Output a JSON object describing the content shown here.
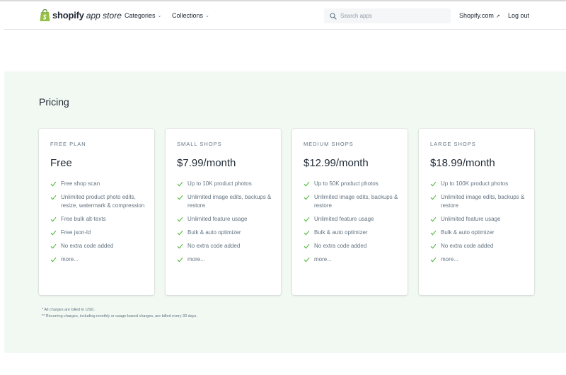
{
  "header": {
    "brand_bold": "shopify",
    "brand_sub": "app store",
    "nav": [
      {
        "label": "Categories"
      },
      {
        "label": "Collections"
      }
    ],
    "search_placeholder": "Search apps",
    "shopify_link": "Shopify.com",
    "logout": "Log out"
  },
  "pricing": {
    "title": "Pricing",
    "plans": [
      {
        "name": "FREE PLAN",
        "price": "Free",
        "features": [
          "Free shop scan",
          "Unlimited product photo edits, resize, watermark & compression",
          "Free bulk alt-texts",
          "Free json-ld",
          "No extra code added",
          "more..."
        ]
      },
      {
        "name": "SMALL SHOPS",
        "price": "$7.99/month",
        "features": [
          "Up to 10K product photos",
          "Unlimited image edits, backups & restore",
          "Unlimited feature usage",
          "Bulk & auto optimizer",
          "No extra code added",
          "more..."
        ]
      },
      {
        "name": "MEDIUM SHOPS",
        "price": "$12.99/month",
        "features": [
          "Up to 50K product photos",
          "Unlimited image edits, backups & restore",
          "Unlimited feature usage",
          "Bulk & auto optimizer",
          "No extra code added",
          "more..."
        ]
      },
      {
        "name": "LARGE SHOPS",
        "price": "$18.99/month",
        "features": [
          "Up to 100K product photos",
          "Unlimited image edits, backups & restore",
          "Unlimited feature usage",
          "Bulk & auto optimizer",
          "No extra code added",
          "more..."
        ]
      }
    ],
    "footnotes": [
      "* All charges are billed in USD.",
      "** Recurring charges, including monthly or usage-based charges, are billed every 30 days."
    ]
  },
  "colors": {
    "brand_green": "#95bf47",
    "check_green": "#50b83c",
    "pricing_bg": "#f2f9f3"
  },
  "icons": {
    "logo": "shopify-bag-icon",
    "search": "search-icon",
    "chevron": "chevron-down-icon",
    "external": "external-link-icon",
    "check": "check-icon"
  }
}
